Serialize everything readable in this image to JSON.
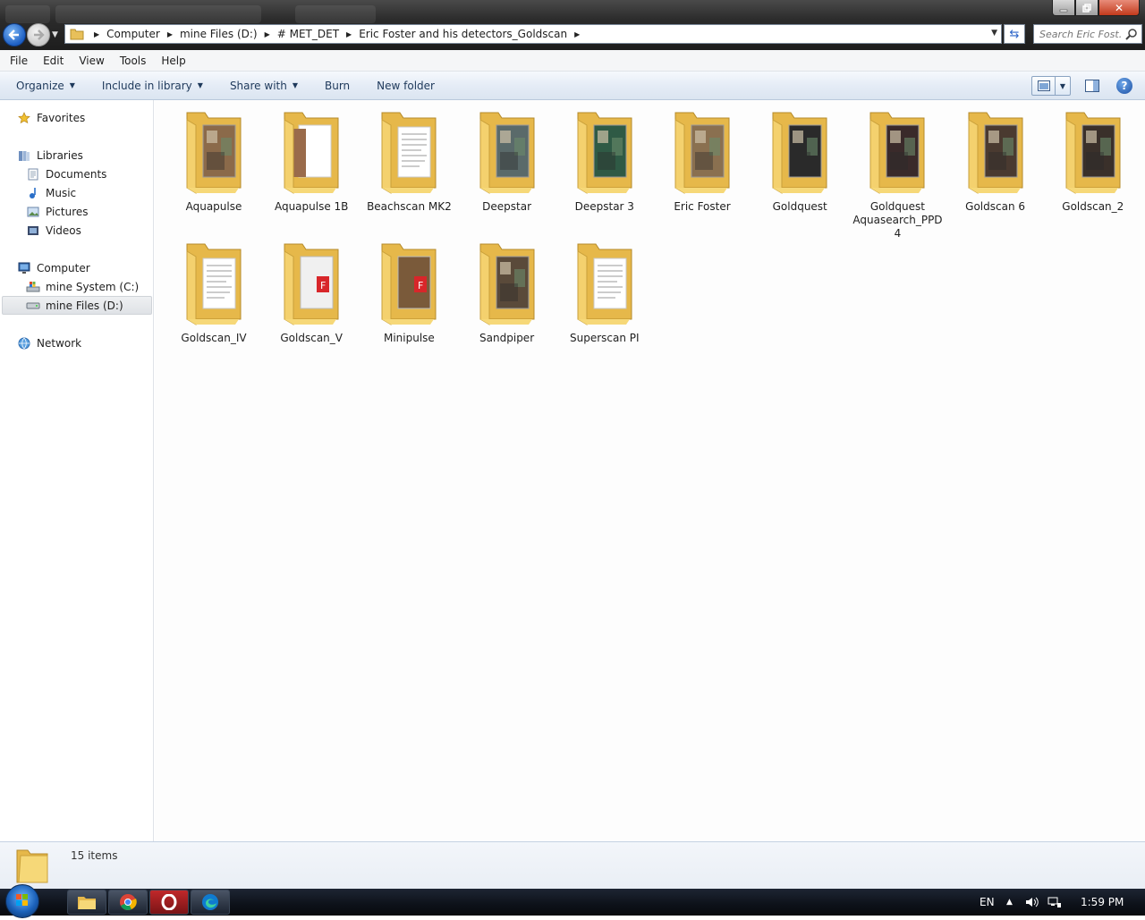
{
  "window": {
    "breadcrumbs": [
      "Computer",
      "mine Files (D:)",
      "# MET_DET",
      "Eric Foster and his detectors_Goldscan"
    ],
    "search_placeholder": "Search Eric Fost..."
  },
  "menubar": [
    "File",
    "Edit",
    "View",
    "Tools",
    "Help"
  ],
  "commandbar": {
    "organize": "Organize",
    "include_library": "Include in library",
    "share_with": "Share with",
    "burn": "Burn",
    "new_folder": "New folder"
  },
  "navigation": {
    "favorites": "Favorites",
    "libraries": "Libraries",
    "documents": "Documents",
    "music": "Music",
    "pictures": "Pictures",
    "videos": "Videos",
    "computer": "Computer",
    "drive_c": "mine System (C:)",
    "drive_d": "mine Files (D:)",
    "network": "Network"
  },
  "folders": [
    {
      "name": "Aquapulse",
      "thumb": "photo",
      "tone": "#8b6a4a"
    },
    {
      "name": "Aquapulse 1B",
      "thumb": "brown",
      "tone": "#9a6b4b"
    },
    {
      "name": "Beachscan MK2",
      "thumb": "doc",
      "tone": "#eeeeee"
    },
    {
      "name": "Deepstar",
      "thumb": "photo",
      "tone": "#5a6a6a"
    },
    {
      "name": "Deepstar 3",
      "thumb": "photo",
      "tone": "#2f5a45"
    },
    {
      "name": "Eric Foster",
      "thumb": "photo",
      "tone": "#8a7050"
    },
    {
      "name": "Goldquest",
      "thumb": "photo",
      "tone": "#2a2a2a"
    },
    {
      "name": "Goldquest Aquasearch_PPD 4",
      "thumb": "photo",
      "tone": "#3a2a2a"
    },
    {
      "name": "Goldscan 6",
      "thumb": "photo",
      "tone": "#4a3a30"
    },
    {
      "name": "Goldscan_2",
      "thumb": "photo",
      "tone": "#3a302a"
    },
    {
      "name": "Goldscan_IV",
      "thumb": "doc",
      "tone": "#e8e8e8"
    },
    {
      "name": "Goldscan_V",
      "thumb": "pdf",
      "tone": "#f0f0f0"
    },
    {
      "name": "Minipulse",
      "thumb": "pdf",
      "tone": "#7a5a3a"
    },
    {
      "name": "Sandpiper",
      "thumb": "photo",
      "tone": "#5a4a3a"
    },
    {
      "name": "Superscan PI",
      "thumb": "doc",
      "tone": "#f2f2f2"
    }
  ],
  "details": {
    "count": "15 items"
  },
  "taskbar": {
    "lang": "EN",
    "time": "1:59 PM"
  }
}
